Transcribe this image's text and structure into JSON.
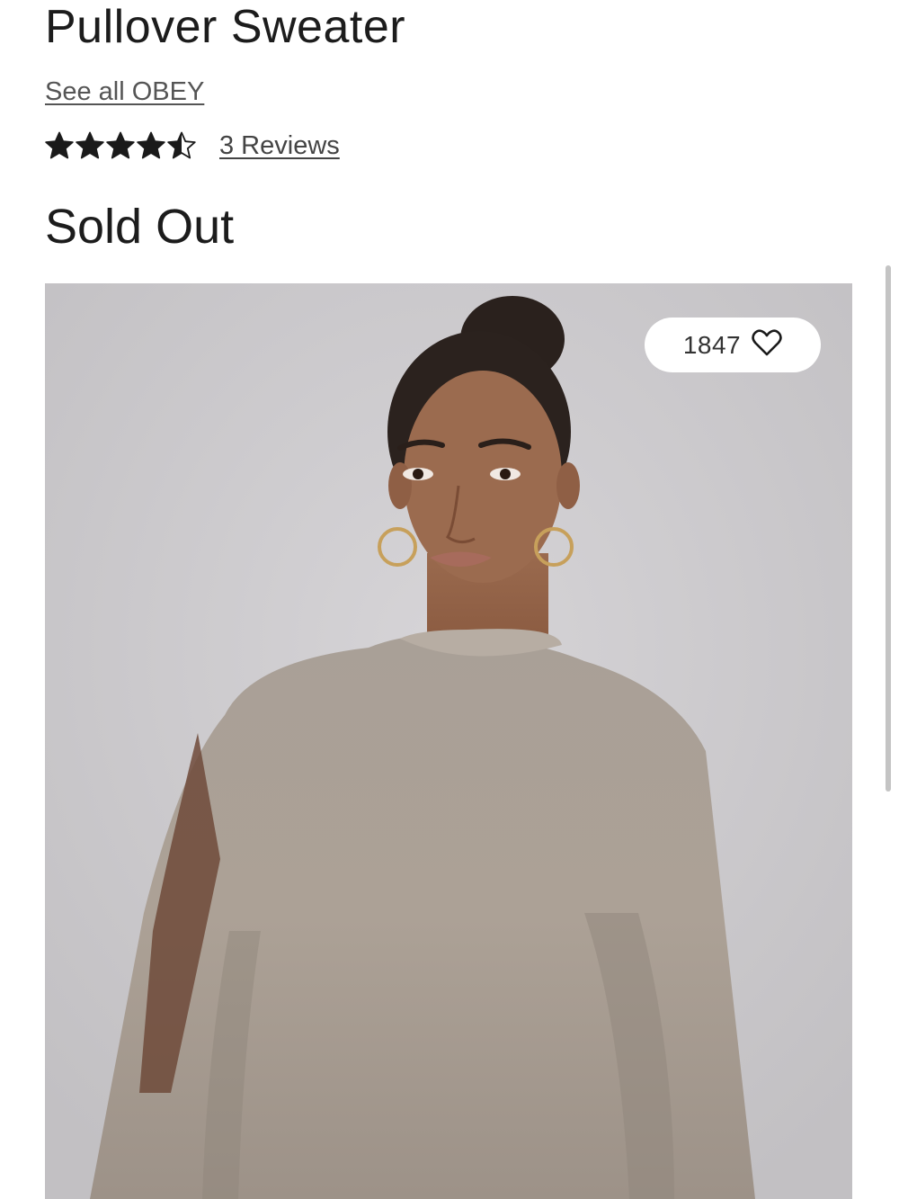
{
  "product": {
    "title": "Pullover Sweater",
    "brand_link": "See all OBEY",
    "rating": 4.5,
    "rating_max": 5,
    "reviews_link": "3 Reviews",
    "status": "Sold Out",
    "favorites_count": "1847"
  },
  "icons": {
    "star": "star-icon",
    "heart": "heart-outline-icon"
  },
  "colors": {
    "text": "#1c1c1c",
    "link": "#555555",
    "image_background": "#cbc9cc",
    "sweater": "#a59a8f"
  }
}
